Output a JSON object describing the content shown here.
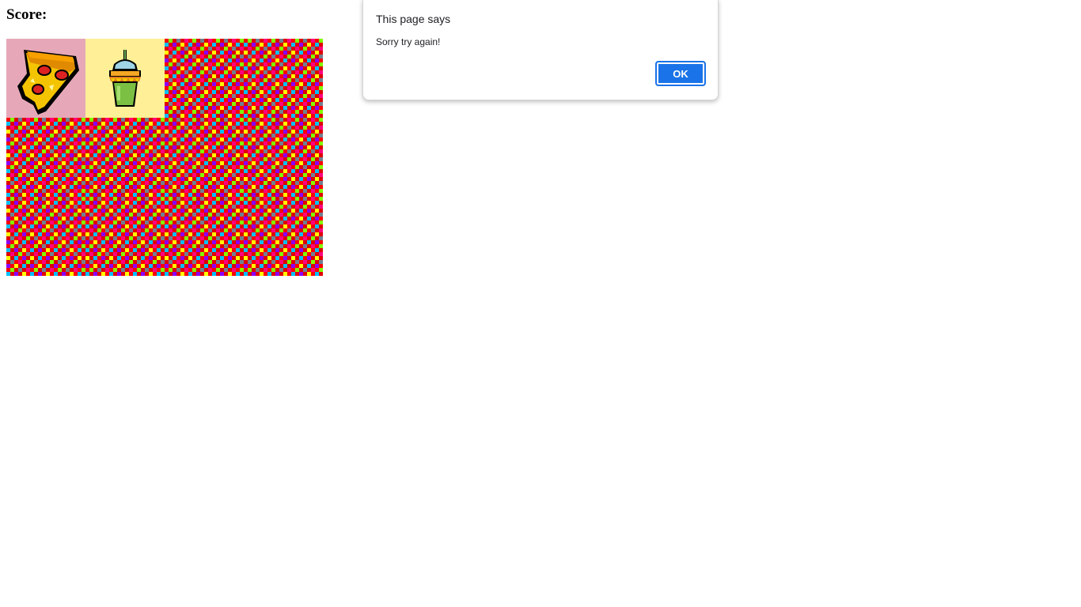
{
  "page": {
    "score_label": "Score:"
  },
  "board": {
    "columns": 4,
    "rows": 3,
    "tiles": [
      {
        "state": "revealed",
        "item": "pizza-icon",
        "background": "#e6a8b8"
      },
      {
        "state": "revealed",
        "item": "slushie-drink-icon",
        "background": "#fff097"
      },
      {
        "state": "hidden"
      },
      {
        "state": "hidden"
      },
      {
        "state": "hidden"
      },
      {
        "state": "hidden"
      },
      {
        "state": "hidden"
      },
      {
        "state": "hidden"
      },
      {
        "state": "hidden"
      },
      {
        "state": "hidden"
      },
      {
        "state": "hidden"
      },
      {
        "state": "hidden"
      }
    ],
    "card_back_colors": [
      "#e00000",
      "#ff0000",
      "#ffff00",
      "#7fff00",
      "#00bfff",
      "#8b00ff",
      "#ff0080",
      "#708090"
    ]
  },
  "dialog": {
    "title": "This page says",
    "message": "Sorry try again!",
    "ok_label": "OK",
    "accent": "#1a73e8"
  }
}
